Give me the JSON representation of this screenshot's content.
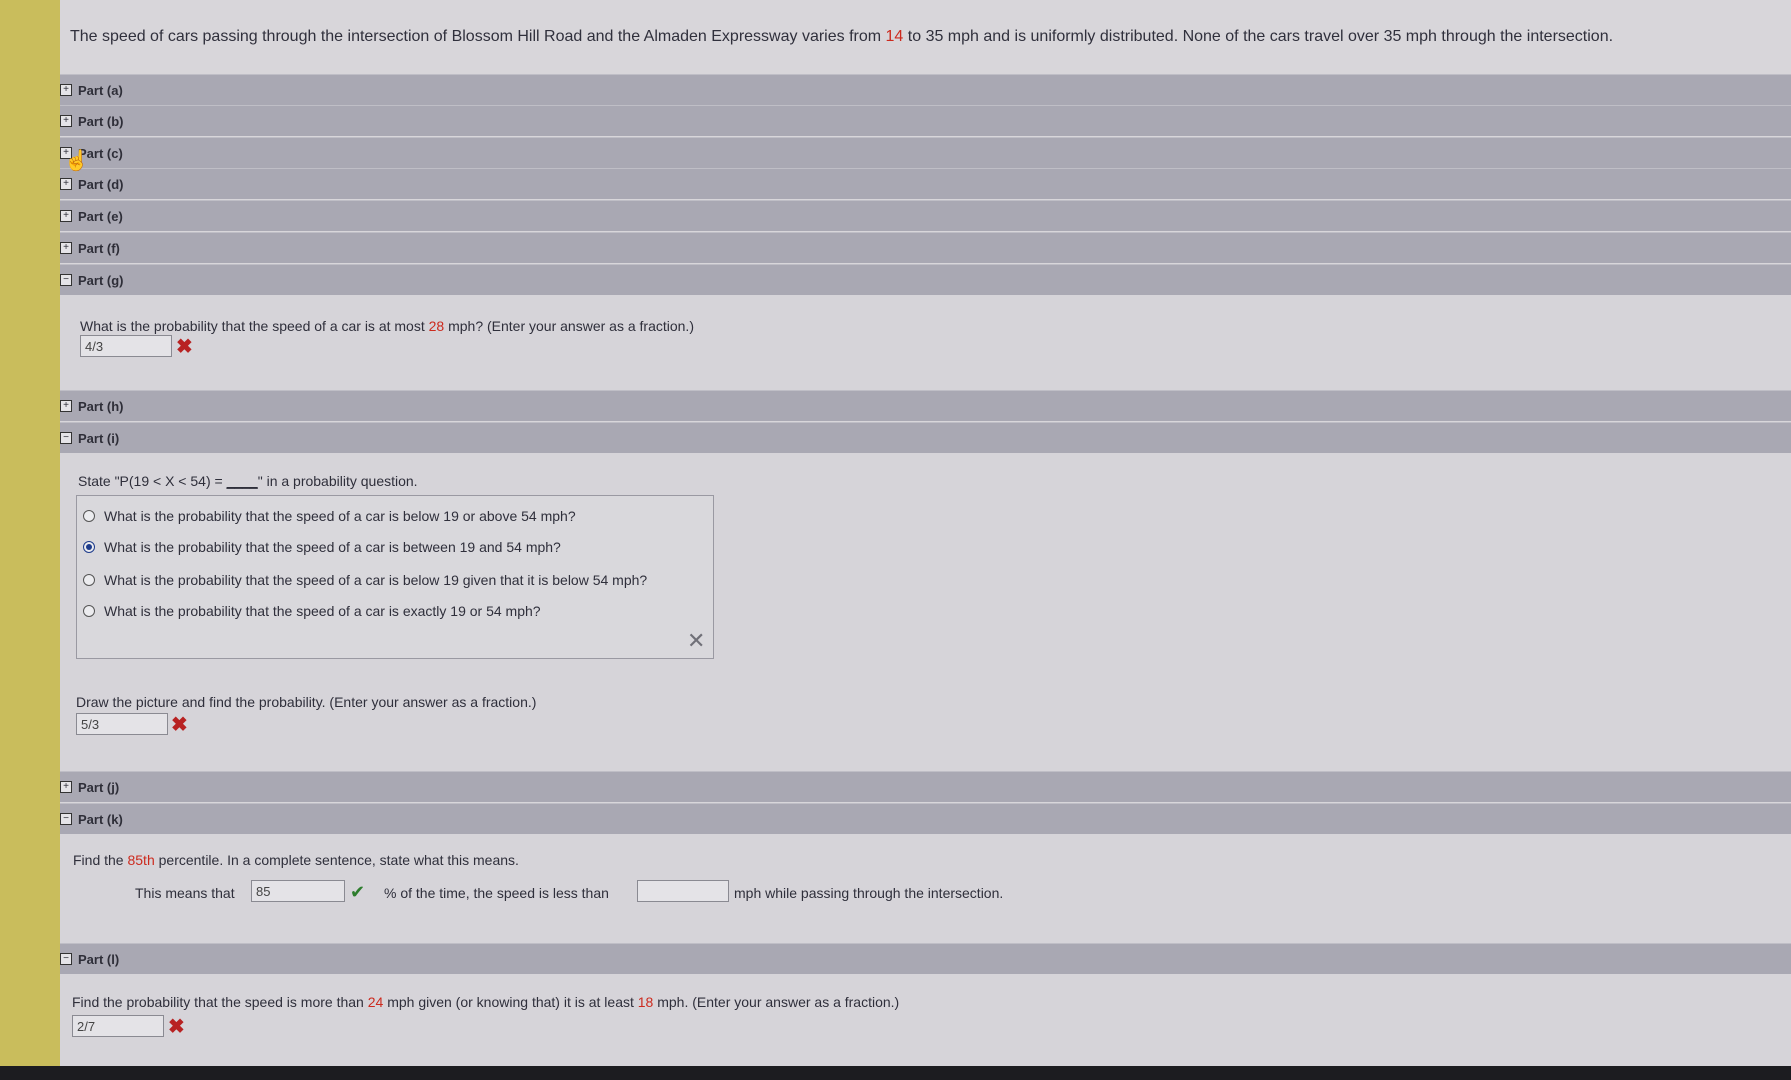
{
  "intro": {
    "pre": "The speed of cars passing through the intersection of Blossom Hill Road and the Almaden Expressway varies from ",
    "v1": "14",
    "mid": " to 35 mph and is uniformly distributed. None of the cars travel over 35 mph through the intersection."
  },
  "parts": {
    "a": "Part (a)",
    "b": "Part (b)",
    "c": "Part (c)",
    "d": "Part (d)",
    "e": "Part (e)",
    "f": "Part (f)",
    "g": "Part (g)",
    "h": "Part (h)",
    "i": "Part (i)",
    "j": "Part (j)",
    "k": "Part (k)",
    "l": "Part (l)"
  },
  "toggle_plus": "+",
  "toggle_minus": "−",
  "part_g": {
    "q_pre": "What is the probability that the speed of a car is at most ",
    "q_val": "28",
    "q_post": " mph? (Enter your answer as a fraction.)",
    "answer": "4/3"
  },
  "part_i": {
    "state_pre": "State \"P(19 < X < 54) = ",
    "state_blank": "____",
    "state_post": "\" in a probability question.",
    "options": [
      "What is the probability that the speed of a car is below 19 or above 54 mph?",
      "What is the probability that the speed of a car is between 19 and 54 mph?",
      "What is the probability that the speed of a car is below 19 given that it is below 54 mph?",
      "What is the probability that the speed of a car is exactly 19 or 54 mph?"
    ],
    "selected_index": 1,
    "draw_text": "Draw the picture and find the probability. (Enter your answer as a fraction.)",
    "draw_answer": "5/3"
  },
  "part_k": {
    "q_pre": "Find the ",
    "q_val": "85th",
    "q_post": " percentile. In a complete sentence, state what this means.",
    "means_pre": "This means that",
    "means_answer": "85",
    "means_mid": "% of the time, the speed is less than",
    "means_answer2": "",
    "means_post": "mph while passing through the intersection."
  },
  "part_l": {
    "q_pre": "Find the probability that the speed is more than ",
    "v1": "24",
    "q_mid": " mph given (or knowing that) it is at least ",
    "v2": "18",
    "q_post": " mph. (Enter your answer as a fraction.)",
    "answer": "2/7"
  },
  "marks": {
    "wrong": "✖",
    "clear": "✕",
    "correct": "✔"
  },
  "colors": {
    "highlight": "#cc2a1e",
    "wrong": "#b82222",
    "correct": "#2d7d2d"
  }
}
